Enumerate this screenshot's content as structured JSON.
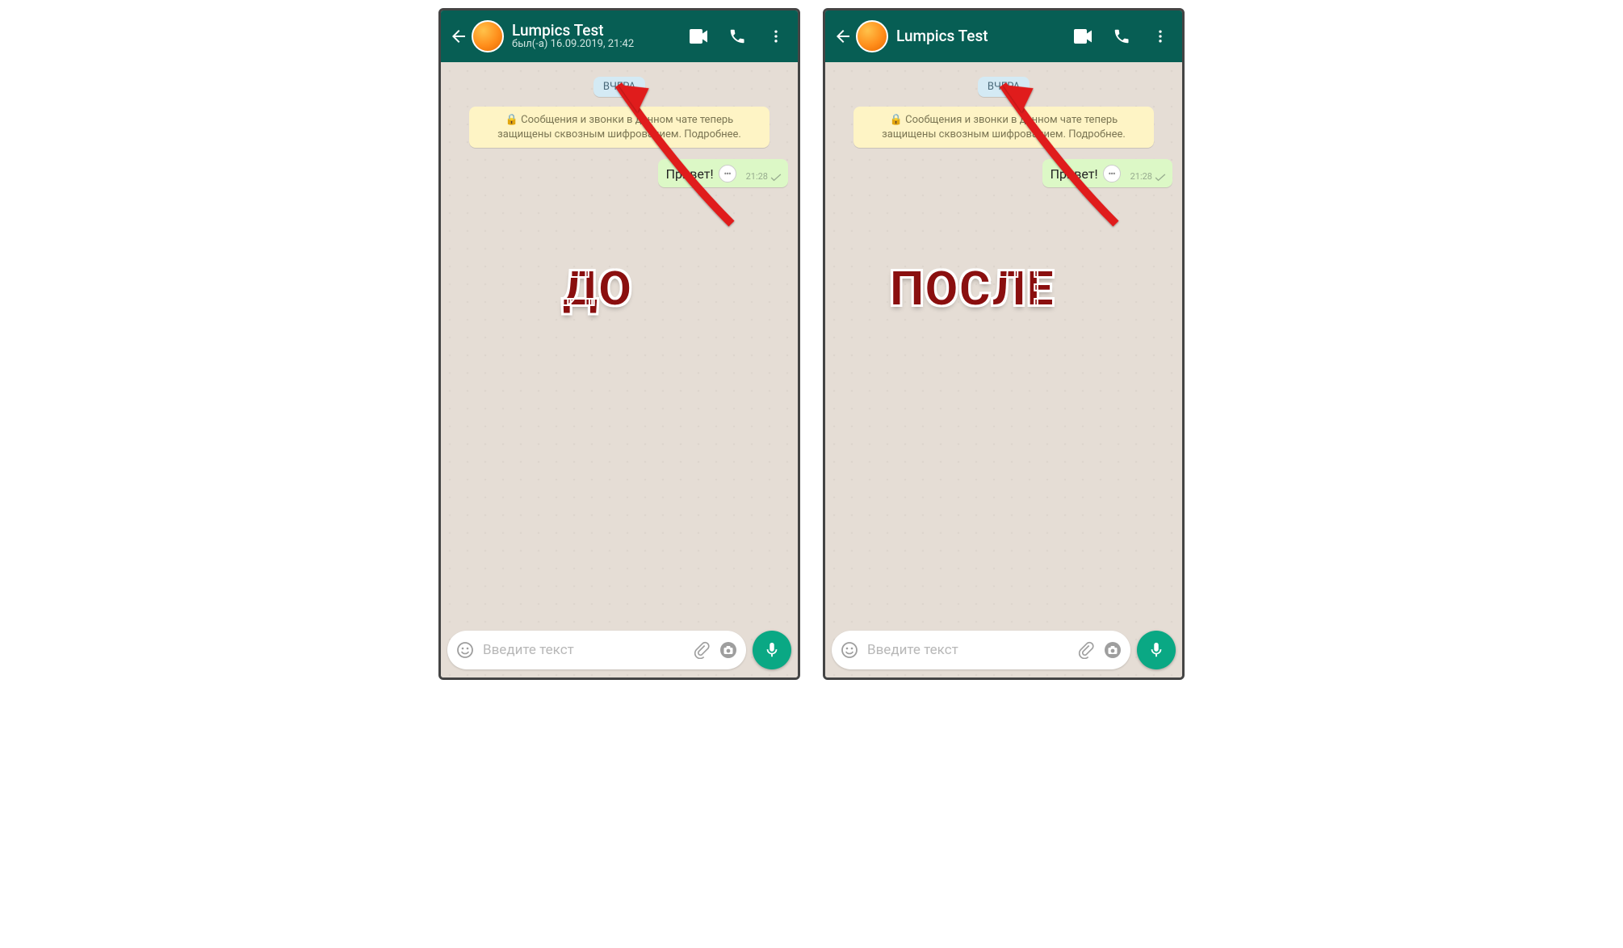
{
  "left": {
    "header": {
      "name": "Lumpics Test",
      "subline": "был(-а) 16.09.2019, 21:42"
    },
    "date_chip": "ВЧЕРА",
    "encryption_notice": "Сообщения и звонки в данном чате теперь защищены сквозным шифрованием. Подробнее.",
    "message": {
      "text": "Привет!",
      "time": "21:28"
    },
    "input_placeholder": "Введите текст",
    "overlay_label": "ДО"
  },
  "right": {
    "header": {
      "name": "Lumpics Test",
      "subline": ""
    },
    "date_chip": "ВЧЕРА",
    "encryption_notice": "Сообщения и звонки в данном чате теперь защищены сквозным шифрованием. Подробнее.",
    "message": {
      "text": "Привет!",
      "time": "21:28"
    },
    "input_placeholder": "Введите текст",
    "overlay_label": "ПОСЛЕ"
  },
  "colors": {
    "header": "#075e54",
    "mic": "#0aa884",
    "bubble": "#dcf8c6",
    "notice": "#fef4c5",
    "arrow": "#e01b1b"
  }
}
